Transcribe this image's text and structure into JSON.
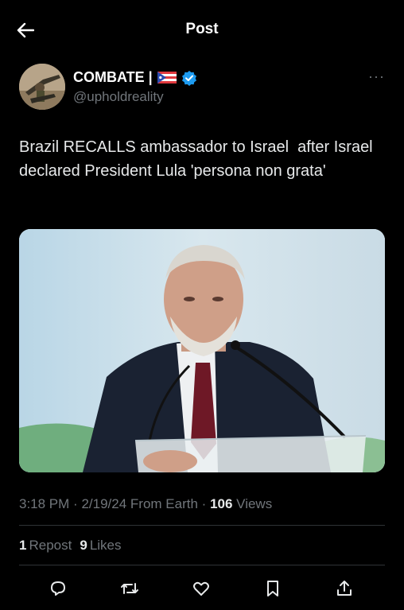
{
  "header": {
    "title": "Post",
    "back_icon": "arrow-left-icon"
  },
  "author": {
    "name": "COMBATE |",
    "flag": "puerto-rico-flag-icon",
    "verified_icon": "verified-badge-icon",
    "verified_color": "#1d9bf0",
    "handle": "@upholdreality",
    "more_label": "···"
  },
  "post": {
    "text": "Brazil RECALLS ambassador to Israel  after Israel declared President Lula 'persona non grata'"
  },
  "meta": {
    "time": "3:18 PM",
    "date": "2/19/24",
    "source": "From Earth",
    "views_count": "106",
    "views_label": "Views"
  },
  "stats": {
    "reposts_count": "1",
    "reposts_label": "Repost",
    "likes_count": "9",
    "likes_label": "Likes"
  },
  "actions": [
    "reply-icon",
    "repost-icon",
    "like-icon",
    "bookmark-icon",
    "share-icon"
  ]
}
